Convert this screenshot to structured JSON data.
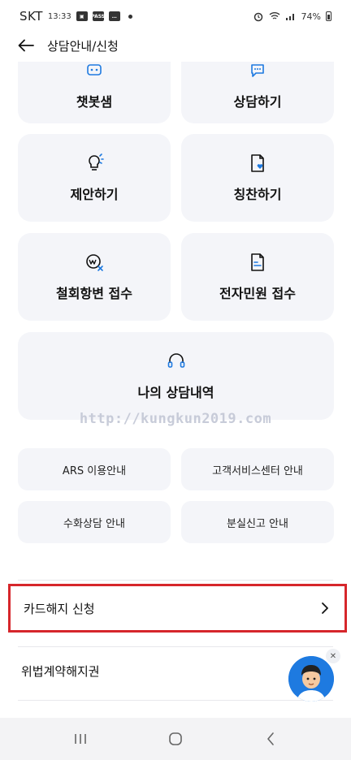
{
  "status_bar": {
    "carrier": "SKT",
    "time": "13:33",
    "pass_badge": "PASS",
    "battery": "74%"
  },
  "app_bar": {
    "title": "상담안내/신청"
  },
  "cards": {
    "chatbot": "챗봇샘",
    "consult": "상담하기",
    "suggest": "제안하기",
    "praise": "칭찬하기",
    "withdrawal": "철회항변 접수",
    "e_civil": "전자민원 접수",
    "my_history": "나의 상담내역"
  },
  "watermark": "http://kungkun2019.com",
  "small_cards": {
    "ars": "ARS 이용안내",
    "customer_center": "고객서비스센터 안내",
    "sign_language": "수화상담 안내",
    "lost_report": "분실신고 안내"
  },
  "list": {
    "card_cancel": "카드해지 신청",
    "illegal_contract": "위법계약해지권"
  },
  "colors": {
    "card_bg": "#f4f5f9",
    "accent": "#1e7ae0",
    "highlight_border": "#d6262b"
  }
}
